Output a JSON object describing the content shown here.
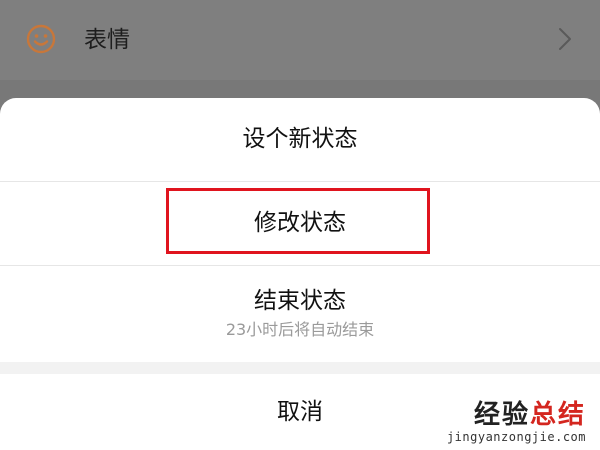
{
  "background_row": {
    "icon": "smiley-face-icon",
    "label": "表情",
    "chevron": "chevron-right-icon"
  },
  "action_sheet": {
    "items": [
      {
        "label": "设个新状态"
      },
      {
        "label": "修改状态",
        "highlighted": true
      },
      {
        "label": "结束状态",
        "sublabel": "23小时后将自动结束"
      }
    ],
    "cancel_label": "取消"
  },
  "colors": {
    "highlight_border": "#e0141e",
    "icon_orange": "#c8773a"
  },
  "watermark": {
    "main_part1": "经验",
    "main_part2": "总结",
    "sub": "jingyanzongjie.com"
  }
}
